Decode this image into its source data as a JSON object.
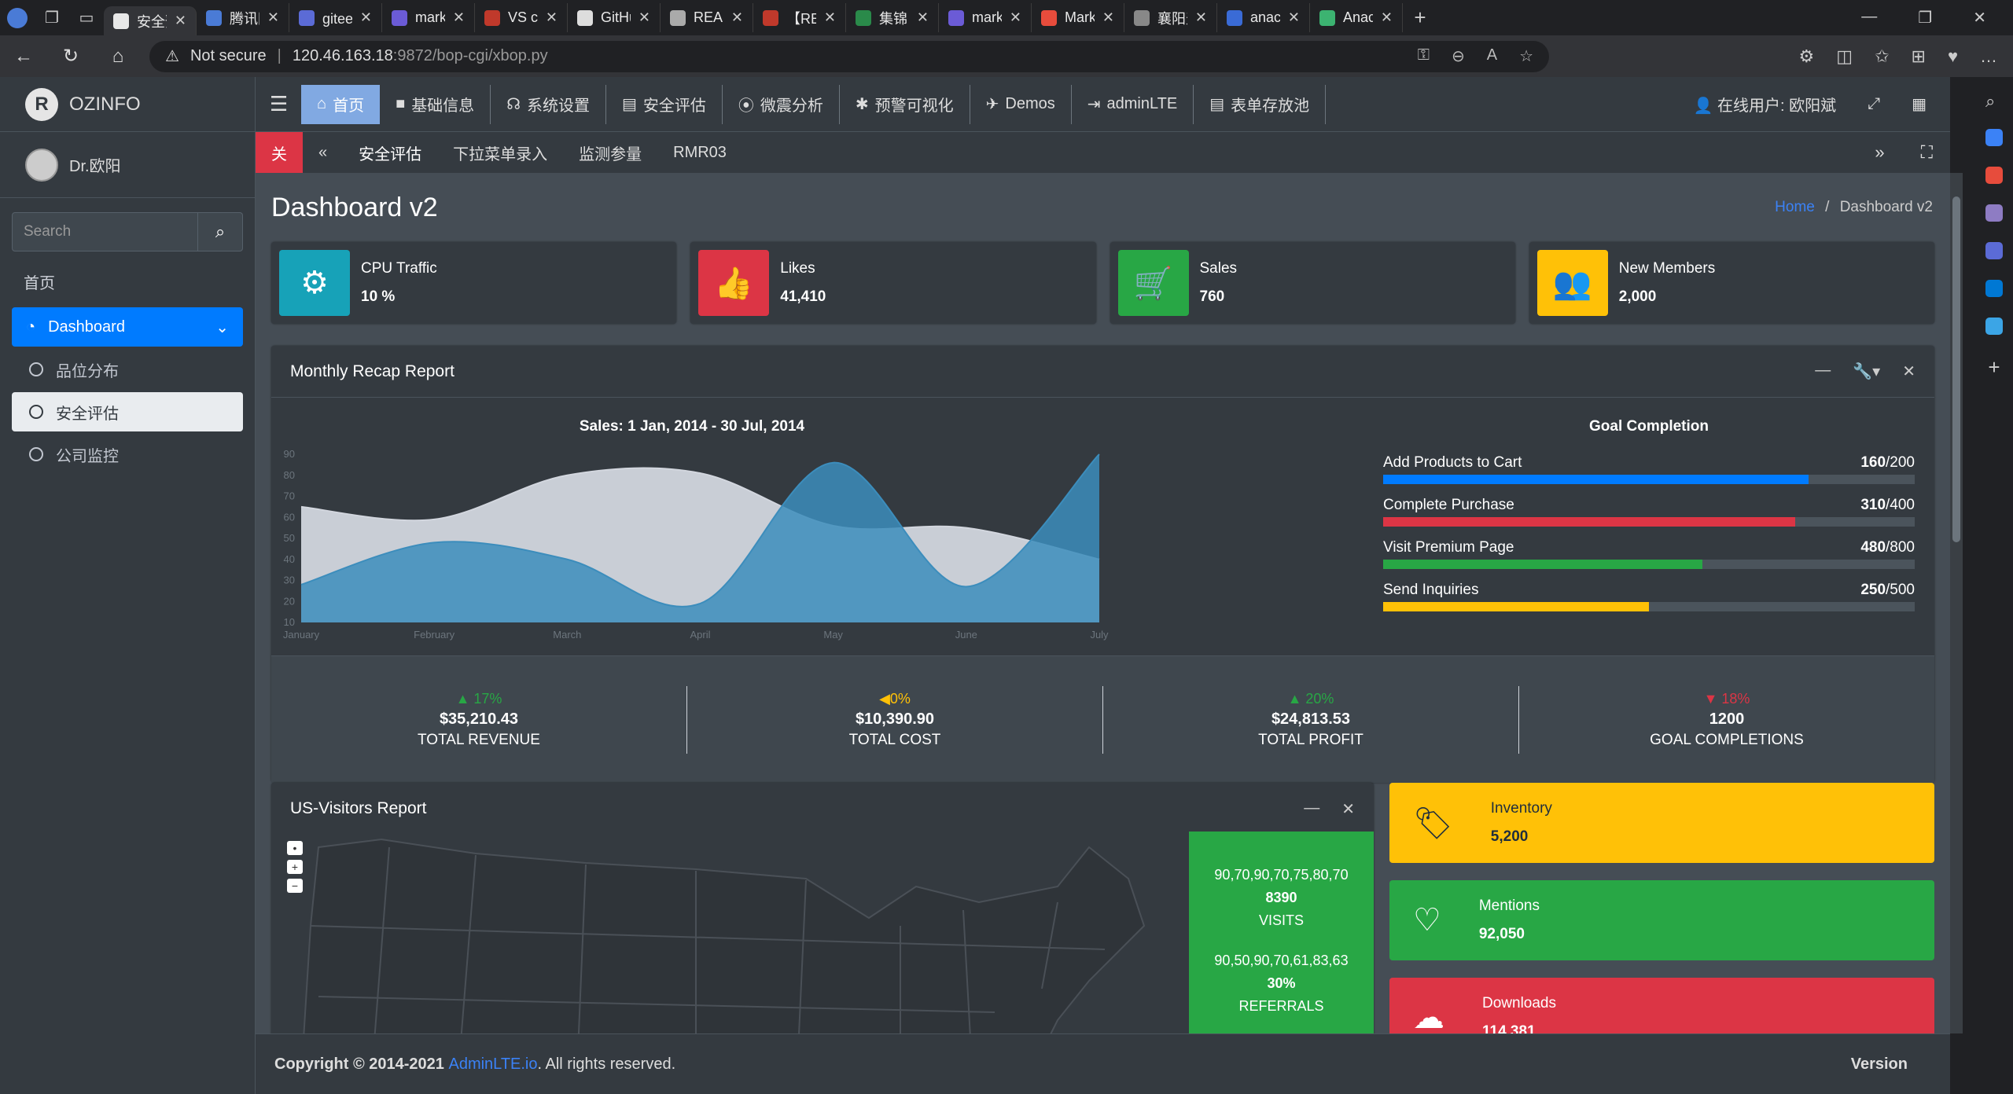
{
  "browser": {
    "tabs": [
      {
        "label": "安全预",
        "color": "#e8e8e8",
        "active": true
      },
      {
        "label": "腾讯网",
        "color": "#4a7bd6"
      },
      {
        "label": "gitee 决",
        "color": "#5b6bd6"
      },
      {
        "label": "markd",
        "color": "#6b5bd6"
      },
      {
        "label": "VS cod",
        "color": "#c0392b"
      },
      {
        "label": "GitHub",
        "color": "#ddd"
      },
      {
        "label": "READM",
        "color": "#aaa"
      },
      {
        "label": "【READ",
        "color": "#c0392b"
      },
      {
        "label": "集锦",
        "color": "#2a8a4a"
      },
      {
        "label": "markd",
        "color": "#6b5bd6"
      },
      {
        "label": "MarkD",
        "color": "#e74c3c"
      },
      {
        "label": "襄阳天",
        "color": "#888"
      },
      {
        "label": "anacon",
        "color": "#3a6bd6"
      },
      {
        "label": "Anacor",
        "color": "#3cb371"
      }
    ],
    "address": {
      "warning": "Not secure",
      "host": "120.46.163.18",
      "rest": ":9872/bop-cgi/xbop.py"
    }
  },
  "sidebar": {
    "brand": "OZINFO",
    "user": "Dr.欧阳",
    "search_placeholder": "Search",
    "header": "首页",
    "items": [
      {
        "label": "Dashboard",
        "state": "active"
      },
      {
        "label": "品位分布",
        "state": ""
      },
      {
        "label": "安全评估",
        "state": "selected"
      },
      {
        "label": "公司监控",
        "state": ""
      }
    ]
  },
  "topnav": {
    "items": [
      "首页",
      "基础信息",
      "系统设置",
      "安全评估",
      "微震分析",
      "预警可视化",
      "Demos",
      "adminLTE",
      "表单存放池"
    ],
    "online_user": "在线用户: 欧阳斌"
  },
  "tabbar": {
    "close": "关",
    "items": [
      "安全评估",
      "下拉菜单录入",
      "监测参量",
      "RMR03"
    ]
  },
  "page": {
    "title": "Dashboard v2",
    "breadcrumb_home": "Home",
    "breadcrumb_current": "Dashboard v2"
  },
  "info_boxes": [
    {
      "label": "CPU Traffic",
      "value": "10 %",
      "color": "#17a2b8",
      "icon": "gear-icon"
    },
    {
      "label": "Likes",
      "value": "41,410",
      "color": "#dc3545",
      "icon": "thumbs-up-icon"
    },
    {
      "label": "Sales",
      "value": "760",
      "color": "#28a745",
      "icon": "cart-icon"
    },
    {
      "label": "New Members",
      "value": "2,000",
      "color": "#ffc107",
      "icon": "users-icon"
    }
  ],
  "recap": {
    "title": "Monthly Recap Report",
    "goal_title": "Goal Completion",
    "goals": [
      {
        "label": "Add Products to Cart",
        "value": "160",
        "total": "/200",
        "fraction": 0.8,
        "color": "#007bff"
      },
      {
        "label": "Complete Purchase",
        "value": "310",
        "total": "/400",
        "fraction": 0.775,
        "color": "#dc3545"
      },
      {
        "label": "Visit Premium Page",
        "value": "480",
        "total": "/800",
        "fraction": 0.6,
        "color": "#28a745"
      },
      {
        "label": "Send Inquiries",
        "value": "250",
        "total": "/500",
        "fraction": 0.5,
        "color": "#ffc107"
      }
    ],
    "stats": [
      {
        "pct": "17%",
        "dir": "up",
        "value": "$35,210.43",
        "label": "TOTAL REVENUE",
        "color": "#28a745"
      },
      {
        "pct": "0%",
        "dir": "left",
        "value": "$10,390.90",
        "label": "TOTAL COST",
        "color": "#ffc107"
      },
      {
        "pct": "20%",
        "dir": "up",
        "value": "$24,813.53",
        "label": "TOTAL PROFIT",
        "color": "#28a745"
      },
      {
        "pct": "18%",
        "dir": "down",
        "value": "1200",
        "label": "GOAL COMPLETIONS",
        "color": "#dc3545"
      }
    ]
  },
  "chart_data": {
    "type": "area",
    "title": "Sales: 1 Jan, 2014 - 30 Jul, 2014",
    "categories": [
      "January",
      "February",
      "March",
      "April",
      "May",
      "June",
      "July"
    ],
    "yticks": [
      10,
      20,
      30,
      40,
      50,
      60,
      70,
      80,
      90
    ],
    "ylim": [
      10,
      90
    ],
    "series": [
      {
        "values": [
          65,
          59,
          80,
          81,
          56,
          55,
          40
        ],
        "color": "#d2d6de"
      },
      {
        "values": [
          28,
          48,
          40,
          19,
          86,
          27,
          90
        ],
        "color": "#3c8dbc"
      }
    ]
  },
  "visitors": {
    "title": "US-Visitors Report",
    "stats": [
      {
        "spark": "90,70,90,70,75,80,70",
        "value": "8390",
        "label": "VISITS"
      },
      {
        "spark": "90,50,90,70,61,83,63",
        "value": "30%",
        "label": "REFERRALS"
      }
    ]
  },
  "small_boxes": [
    {
      "label": "Inventory",
      "value": "5,200",
      "color": "#ffc107",
      "text": "#1f2d3d",
      "icon": "tag-icon"
    },
    {
      "label": "Mentions",
      "value": "92,050",
      "color": "#28a745",
      "text": "#ffffff",
      "icon": "heart-icon"
    },
    {
      "label": "Downloads",
      "value": "114,381",
      "color": "#dc3545",
      "text": "#ffffff",
      "icon": "cloud-download-icon"
    }
  ],
  "footer": {
    "prefix": "Copyright © 2014-2021 ",
    "link": "AdminLTE.io",
    "suffix": ". All rights reserved.",
    "version": "Version"
  }
}
